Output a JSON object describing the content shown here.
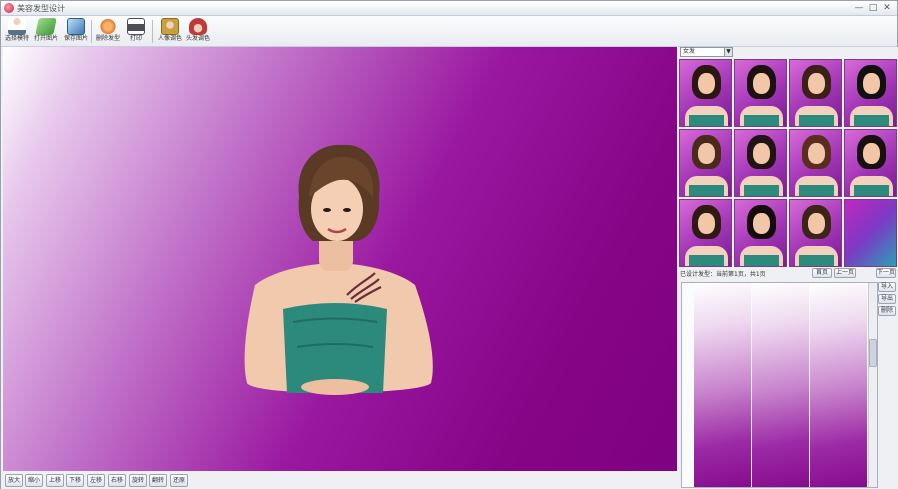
{
  "window": {
    "title": "美容发型设计",
    "controls": [
      "—",
      "□",
      "✕"
    ]
  },
  "toolbar": {
    "buttons": [
      {
        "label": "选择模特",
        "icon": "model-icon",
        "color": "#5a6f8c"
      },
      {
        "label": "打开图片",
        "icon": "open-image-icon",
        "color": "#3f9a3a"
      },
      {
        "label": "保存图片",
        "icon": "save-image-icon",
        "color": "#3a78b8"
      },
      {
        "label": "删除发型",
        "icon": "delete-hair-icon",
        "color": "#e07a28"
      },
      {
        "label": "打印",
        "icon": "printer-icon",
        "color": "#4a4f58"
      },
      {
        "label": "人像调色",
        "icon": "color-adjust-icon",
        "color": "#c8a040"
      },
      {
        "label": "头发调色",
        "icon": "hair-color-icon",
        "color": "#c03a3a"
      }
    ]
  },
  "bottom_bar": {
    "buttons": [
      "放大",
      "缩小",
      "上移",
      "下移",
      "左移",
      "右移",
      "旋转",
      "翻转",
      "还原"
    ]
  },
  "right_panel": {
    "category_select": {
      "value": "女发"
    },
    "hair_thumbnails": [
      {
        "name": "hairstyle-1",
        "hair_color": "#2a1712"
      },
      {
        "name": "hairstyle-2",
        "hair_color": "#1c1010"
      },
      {
        "name": "hairstyle-3",
        "hair_color": "#3a2016"
      },
      {
        "name": "hairstyle-4",
        "hair_color": "#101010"
      },
      {
        "name": "hairstyle-5",
        "hair_color": "#4a2a1a"
      },
      {
        "name": "hairstyle-6",
        "hair_color": "#201414"
      },
      {
        "name": "hairstyle-7",
        "hair_color": "#5a2e1e"
      },
      {
        "name": "hairstyle-8",
        "hair_color": "#181010"
      },
      {
        "name": "hairstyle-9",
        "hair_color": "#2e1a12"
      },
      {
        "name": "hairstyle-10",
        "hair_color": "#140c0a"
      },
      {
        "name": "hairstyle-11",
        "hair_color": "#3c2418"
      },
      {
        "name": "hairstyle-12",
        "hair_color": null
      }
    ],
    "list_label": "已设计发型：当前第1页，共1页",
    "nav_buttons": [
      "首页",
      "上一页",
      "下一页"
    ],
    "side_buttons": [
      "导入",
      "导出",
      "删除"
    ]
  },
  "colors": {
    "canvas_purple": "#870487",
    "window_bg": "#eef0f4"
  }
}
